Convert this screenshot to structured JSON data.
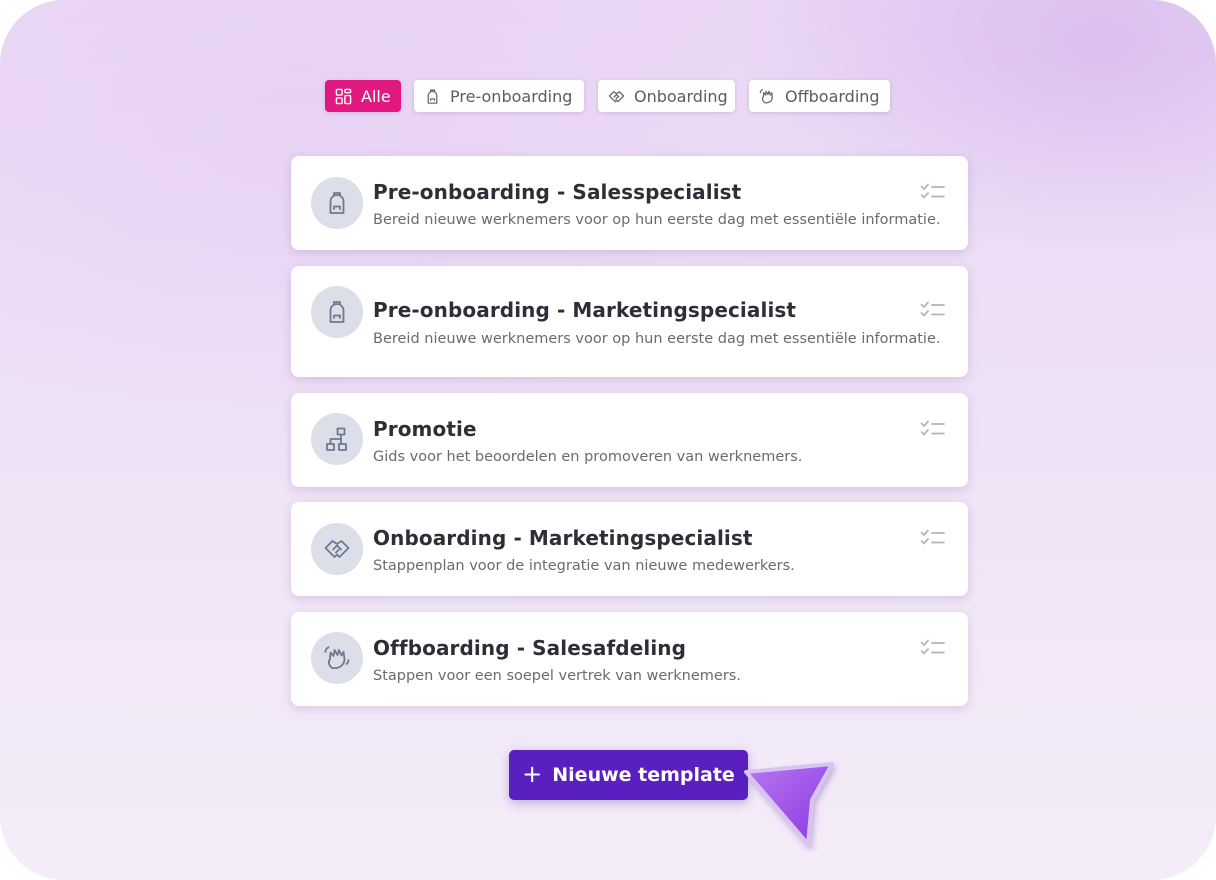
{
  "filters": {
    "all": "Alle",
    "pre_onboarding": "Pre-onboarding",
    "onboarding": "Onboarding",
    "offboarding": "Offboarding",
    "active": "Alle"
  },
  "templates": [
    {
      "title": "Pre-onboarding - Salesspecialist",
      "description": "Bereid nieuwe werknemers voor op hun eerste dag met essentiële informatie.",
      "icon": "backpack-icon"
    },
    {
      "title": "Pre-onboarding - Marketingspecialist",
      "description": "Bereid nieuwe werknemers voor op hun eerste dag met essentiële informatie.",
      "icon": "backpack-icon"
    },
    {
      "title": "Promotie",
      "description": "Gids voor het beoordelen en promoveren van werknemers.",
      "icon": "hierarchy-icon"
    },
    {
      "title": "Onboarding - Marketingspecialist",
      "description": "Stappenplan voor de integratie van nieuwe medewerkers.",
      "icon": "handshake-icon"
    },
    {
      "title": "Offboarding - Salesafdeling",
      "description": "Stappen voor een soepel vertrek van werknemers.",
      "icon": "waving-hand-icon"
    }
  ],
  "new_template": {
    "label": "Nieuwe template",
    "icon": "plus-icon"
  },
  "colors": {
    "active_filter": "#e0187f",
    "primary_button": "#5a1fc1",
    "cursor": "#9b4be6"
  }
}
